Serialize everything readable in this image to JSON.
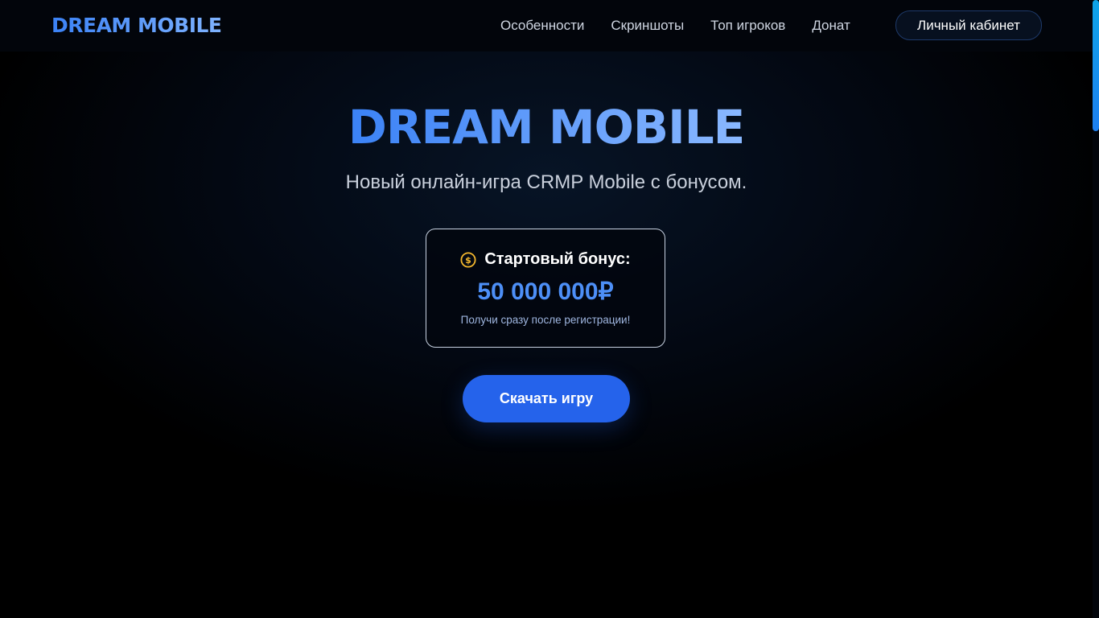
{
  "header": {
    "logo": "DREAM MOBILE",
    "nav": [
      {
        "label": "Особенности"
      },
      {
        "label": "Скриншоты"
      },
      {
        "label": "Топ игроков"
      },
      {
        "label": "Донат"
      }
    ],
    "cabinet_button": "Личный кабинет"
  },
  "hero": {
    "title": "DREAM MOBILE",
    "subtitle": "Новый онлайн-игра CRMP Mobile с бонусом.",
    "bonus": {
      "icon": "dollar-coin-icon",
      "label": "Стартовый бонус:",
      "amount": "50 000 000₽",
      "note": "Получи сразу после регистрации!"
    },
    "download_button": "Скачать игру"
  },
  "colors": {
    "accent": "#2563eb",
    "title_gradient_start": "#3b82f6",
    "title_gradient_end": "#8ab8ff",
    "coin": "#f5b82e",
    "scrollbar": "#0ea5e9"
  }
}
